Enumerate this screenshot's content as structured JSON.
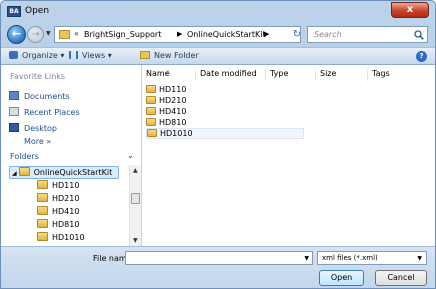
{
  "window": {
    "title": "Open",
    "app_icon": "BA",
    "close_glyph": "x"
  },
  "nav": {
    "back_glyph": "←",
    "forward_glyph": "→",
    "breadcrumb": [
      "BrightSign_Support",
      "OnlineQuickStartKit"
    ],
    "overflow_glyph": "«",
    "search_placeholder": "Search"
  },
  "toolbar": {
    "organize": "Organize ▾",
    "views": "Views ▾",
    "new_folder": "New Folder"
  },
  "sidebar": {
    "favorites_header": "Favorite Links",
    "favorites": [
      {
        "label": "Documents",
        "icon": "documents-icon"
      },
      {
        "label": "Recent Places",
        "icon": "recent-places-icon"
      },
      {
        "label": "Desktop",
        "icon": "desktop-icon"
      }
    ],
    "more": "More »",
    "folders_header": "Folders",
    "tree": [
      {
        "label": "OnlineQuickStartKit",
        "selected": true
      },
      {
        "label": "HD110"
      },
      {
        "label": "HD210"
      },
      {
        "label": "HD410"
      },
      {
        "label": "HD810"
      },
      {
        "label": "HD1010"
      }
    ]
  },
  "columns": [
    "Name",
    "Date modified",
    "Type",
    "Size",
    "Tags"
  ],
  "files": [
    "HD110",
    "HD210",
    "HD410",
    "HD810",
    "HD1010"
  ],
  "footer": {
    "file_name_label": "File name:",
    "file_name_value": "",
    "filter": "xml files (*.xml)",
    "open": "Open",
    "cancel": "Cancel"
  }
}
